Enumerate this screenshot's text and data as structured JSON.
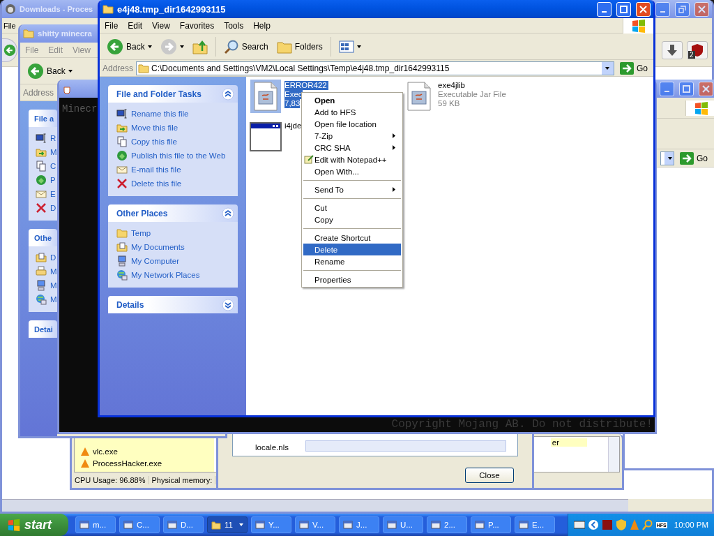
{
  "browser_window": {
    "title": "Downloads - Proces",
    "menu": [
      "File"
    ],
    "badge": "2"
  },
  "process_list": {
    "rows": [
      "vlc.exe",
      "ProcessHacker.exe"
    ],
    "side_text": "er",
    "status": [
      "CPU Usage: 96.88%",
      "Physical memory:"
    ]
  },
  "dialog": {
    "rows": [
      "locale.nls"
    ],
    "close_button": "Close"
  },
  "right_window": {
    "go_button": "Go"
  },
  "back_explorer": {
    "title": "shitty minecra",
    "menu": [
      "File",
      "Edit",
      "View"
    ],
    "back_button": "Back",
    "address_label": "Address",
    "sections": [
      {
        "title": "File a",
        "expanded": true,
        "items": [
          {
            "kind": "rename",
            "label": "R"
          },
          {
            "kind": "move",
            "label": "M"
          },
          {
            "kind": "copy",
            "label": "C"
          },
          {
            "kind": "publish",
            "label": "P"
          },
          {
            "kind": "email",
            "label": "E"
          },
          {
            "kind": "delete",
            "label": "D"
          }
        ]
      },
      {
        "title": "Othe",
        "expanded": true,
        "items": [
          {
            "kind": "documents",
            "label": "D"
          },
          {
            "kind": "printer",
            "label": "M"
          },
          {
            "kind": "computer",
            "label": "M"
          },
          {
            "kind": "network",
            "label": "M"
          }
        ]
      },
      {
        "title": "Detai",
        "expanded": false
      }
    ]
  },
  "game_window": {
    "title": "Minecr",
    "footer": "Copyright Mojang AB. Do not distribute!"
  },
  "main_window": {
    "title": "e4j48.tmp_dir1642993115",
    "menu": [
      "File",
      "Edit",
      "View",
      "Favorites",
      "Tools",
      "Help"
    ],
    "toolbar": {
      "back": "Back",
      "search": "Search",
      "folders": "Folders"
    },
    "address": {
      "label": "Address",
      "value": "C:\\Documents and Settings\\VM2\\Local Settings\\Temp\\e4j48.tmp_dir1642993115",
      "go": "Go"
    },
    "sections": [
      {
        "title": "File and Folder Tasks",
        "expanded": true,
        "items": [
          {
            "kind": "rename",
            "label": "Rename this file"
          },
          {
            "kind": "move",
            "label": "Move this file"
          },
          {
            "kind": "copy",
            "label": "Copy this file"
          },
          {
            "kind": "publish",
            "label": "Publish this file to the Web"
          },
          {
            "kind": "email",
            "label": "E-mail this file"
          },
          {
            "kind": "delete",
            "label": "Delete this file"
          }
        ]
      },
      {
        "title": "Other Places",
        "expanded": true,
        "items": [
          {
            "kind": "folder",
            "label": "Temp"
          },
          {
            "kind": "documents",
            "label": "My Documents"
          },
          {
            "kind": "computer",
            "label": "My Computer"
          },
          {
            "kind": "network",
            "label": "My Network Places"
          }
        ]
      },
      {
        "title": "Details",
        "expanded": false
      }
    ],
    "files": [
      {
        "kind": "jar",
        "name": "ERROR422",
        "lines": [
          "Exec",
          "7,83"
        ],
        "selected": true
      },
      {
        "kind": "jar",
        "name": "exe4jlib",
        "lines": [
          "Executable Jar File",
          "59 KB"
        ],
        "selected": false
      },
      {
        "kind": "app",
        "name": "i4jde",
        "selected": false
      }
    ]
  },
  "context_menu": {
    "items": [
      {
        "kind": "default",
        "label": "Open",
        "submenu": false,
        "selected": false
      },
      {
        "kind": "item",
        "label": "Add to HFS",
        "submenu": false,
        "selected": false
      },
      {
        "kind": "item",
        "label": "Open file location",
        "submenu": false,
        "selected": false
      },
      {
        "kind": "item",
        "label": "7-Zip",
        "submenu": true,
        "selected": false
      },
      {
        "kind": "item",
        "label": "CRC SHA",
        "submenu": true,
        "selected": false
      },
      {
        "kind": "tool",
        "label": "Edit with Notepad++",
        "submenu": false,
        "selected": false
      },
      {
        "kind": "item",
        "label": "Open With...",
        "submenu": false,
        "selected": false
      },
      {
        "kind": "separator"
      },
      {
        "kind": "item",
        "label": "Send To",
        "submenu": true,
        "selected": false
      },
      {
        "kind": "separator"
      },
      {
        "kind": "item",
        "label": "Cut",
        "submenu": false,
        "selected": false
      },
      {
        "kind": "item",
        "label": "Copy",
        "submenu": false,
        "selected": false
      },
      {
        "kind": "separator"
      },
      {
        "kind": "item",
        "label": "Create Shortcut",
        "submenu": false,
        "selected": false
      },
      {
        "kind": "item",
        "label": "Delete",
        "submenu": false,
        "selected": true
      },
      {
        "kind": "item",
        "label": "Rename",
        "submenu": false,
        "selected": false
      },
      {
        "kind": "separator"
      },
      {
        "kind": "item",
        "label": "Properties",
        "submenu": false,
        "selected": false
      }
    ]
  },
  "taskbar": {
    "start": "start",
    "tasks": [
      {
        "kind": "window",
        "label": "m...",
        "selected": false
      },
      {
        "kind": "window",
        "label": "C...",
        "selected": false
      },
      {
        "kind": "window",
        "label": "D...",
        "selected": false
      },
      {
        "kind": "group",
        "label": "11",
        "selected": true
      },
      {
        "kind": "window",
        "label": "Y...",
        "selected": false
      },
      {
        "kind": "window",
        "label": "V...",
        "selected": false
      },
      {
        "kind": "window",
        "label": "J...",
        "selected": false
      },
      {
        "kind": "window",
        "label": "U...",
        "selected": false
      },
      {
        "kind": "window",
        "label": "2...",
        "selected": false
      },
      {
        "kind": "window",
        "label": "P...",
        "selected": false
      },
      {
        "kind": "window",
        "label": "E...",
        "selected": false
      }
    ],
    "tray_badge": "HFS",
    "clock": "10:00 PM"
  }
}
